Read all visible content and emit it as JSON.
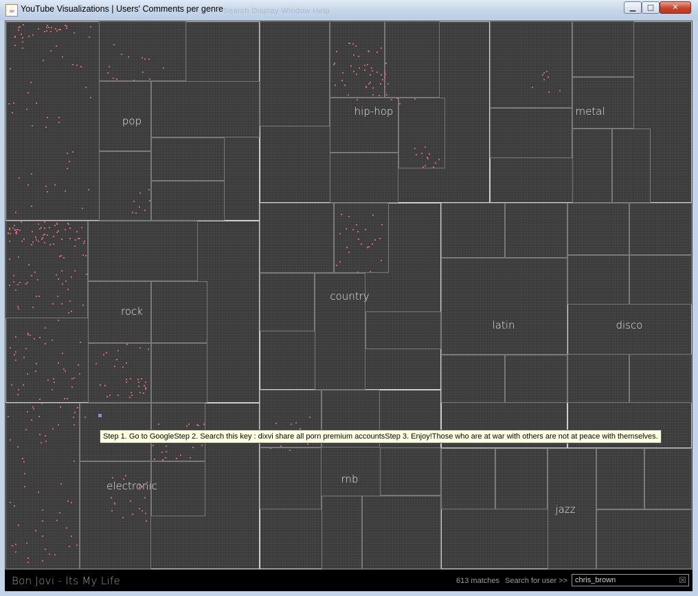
{
  "window": {
    "title": "YouTube Visualizations | Users' Comments per genre",
    "icon": "java-cup-icon",
    "ghost_menu": "Search  Display  Window  Help",
    "controls": {
      "minimize": "▁",
      "maximize": "□",
      "close": "✕"
    }
  },
  "genres": [
    {
      "name": "pop"
    },
    {
      "name": "hip-hop"
    },
    {
      "name": "metal"
    },
    {
      "name": "rock"
    },
    {
      "name": "country"
    },
    {
      "name": "latin"
    },
    {
      "name": "disco"
    },
    {
      "name": "electronic"
    },
    {
      "name": "rnb"
    },
    {
      "name": "jazz"
    }
  ],
  "tooltip": {
    "text": "Step 1. Go to GoogleStep 2. Search this key : dixvi share all porn premium accountsStep 3. Enjoy!Those who are at war with others are not at peace with themselves."
  },
  "bottom_bar": {
    "now_playing": "Bon Jovi - Its My Life",
    "matches": "613 matches",
    "search_label": "Search for user >>",
    "search_value": "chris_brown",
    "clear_icon": "clear-x-icon"
  },
  "colors": {
    "canvas_bg": "#3a3a3a",
    "comment_dot": "#d0687a",
    "genre_border": "#cfcfcf",
    "label_text": "#e6e6e6"
  }
}
